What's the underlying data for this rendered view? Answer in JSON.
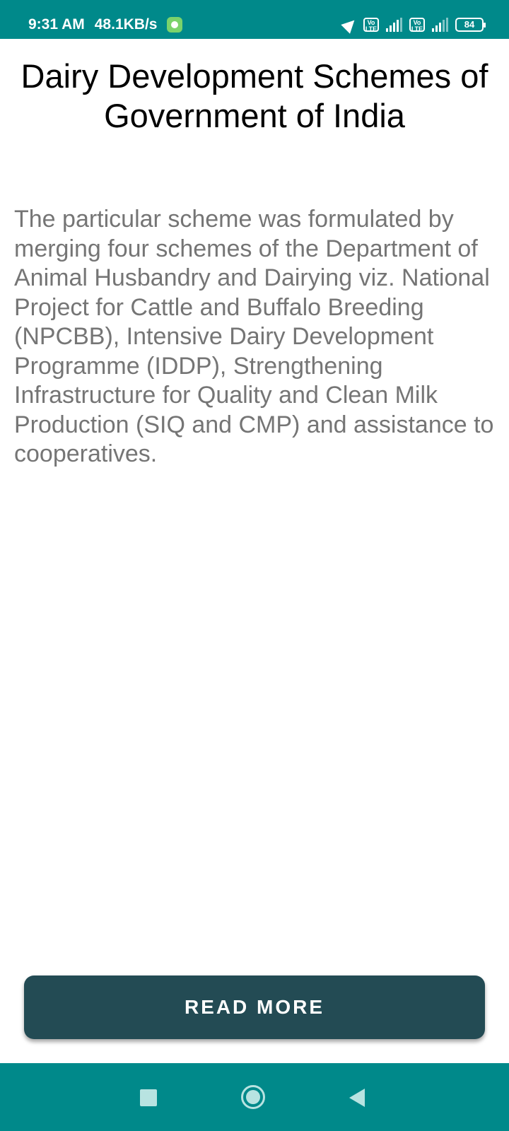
{
  "status_bar": {
    "time": "9:31 AM",
    "network_speed": "48.1KB/s",
    "network_type": "4G",
    "volte_label": "Vo LTE",
    "battery": "84",
    "icons": [
      "app-notification-icon",
      "location-arrow-icon",
      "volte-icon",
      "signal-icon",
      "battery-icon"
    ]
  },
  "page": {
    "title": "Dairy Development Schemes of Government of India",
    "description": "The particular scheme was formulated by merging four schemes of the Department of Animal Husbandry and Dairying viz. National Project for Cattle and Buffalo Breeding (NPCBB), Intensive Dairy Development Programme (IDDP), Strengthening Infrastructure for Quality and Clean Milk Production (SIQ and CMP) and assistance to cooperatives.",
    "read_more_label": "READ MORE"
  },
  "nav_bar": {
    "icons": [
      "recents-square-icon",
      "home-circle-icon",
      "back-triangle-icon"
    ]
  },
  "colors": {
    "status_bar": "#00898a",
    "nav_bar": "#00898a",
    "button_bg": "#234b54",
    "body_text": "#757575",
    "title_text": "#000000"
  }
}
